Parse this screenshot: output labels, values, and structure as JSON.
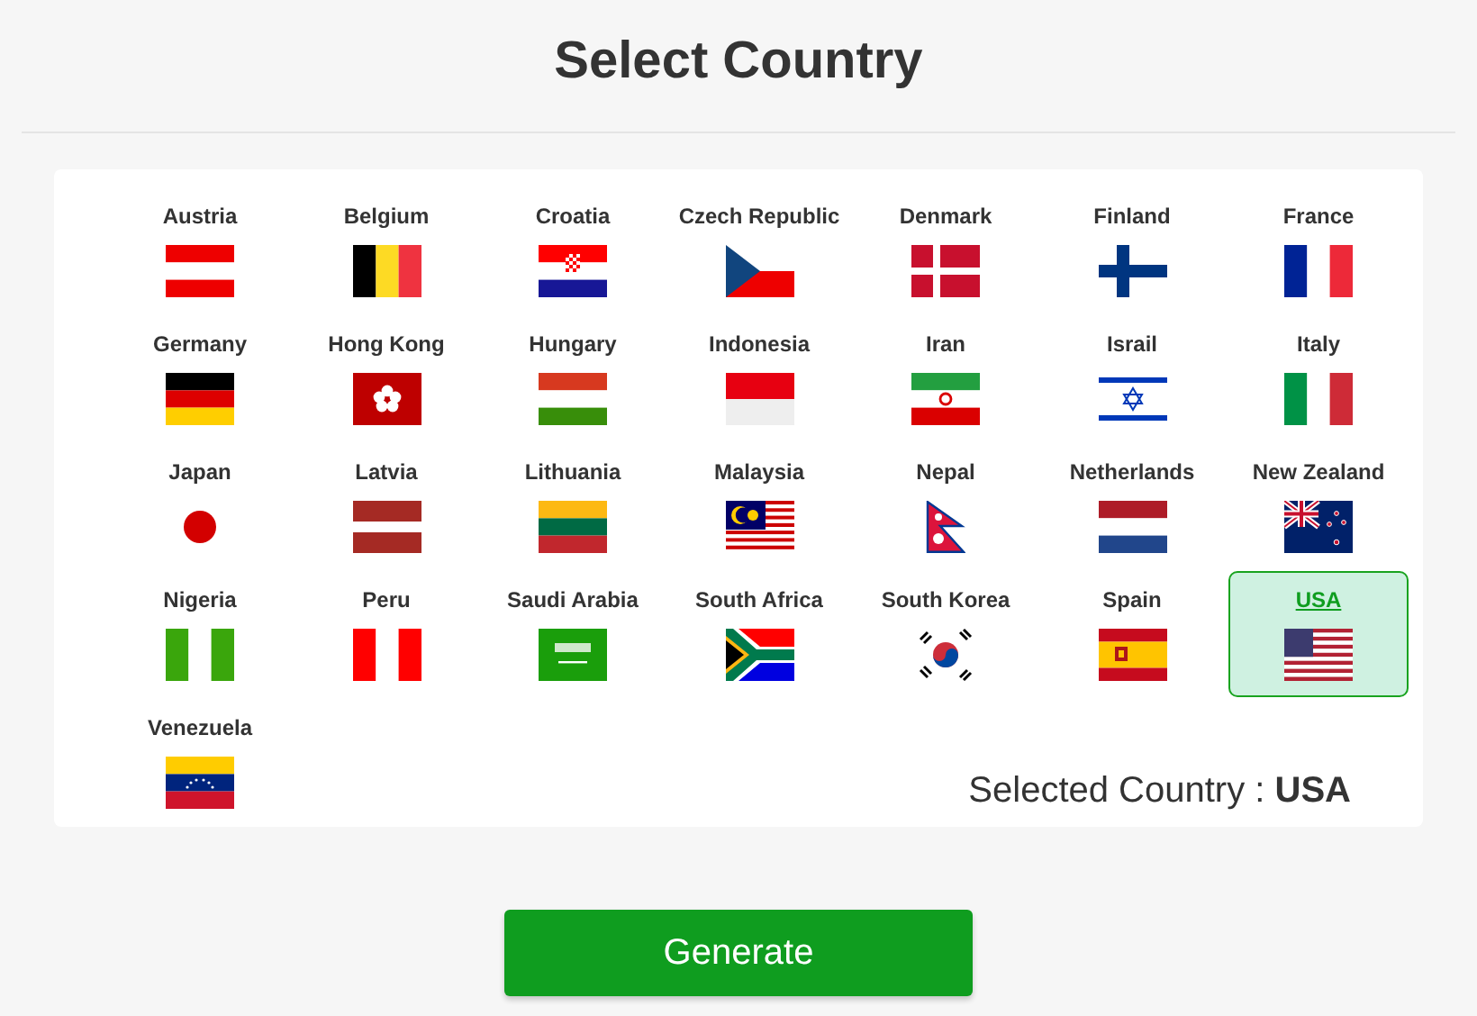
{
  "title": "Select Country",
  "countries": [
    {
      "name": "Austria",
      "selected": false
    },
    {
      "name": "Belgium",
      "selected": false
    },
    {
      "name": "Croatia",
      "selected": false
    },
    {
      "name": "Czech Republic",
      "selected": false
    },
    {
      "name": "Denmark",
      "selected": false
    },
    {
      "name": "Finland",
      "selected": false
    },
    {
      "name": "France",
      "selected": false
    },
    {
      "name": "Germany",
      "selected": false
    },
    {
      "name": "Hong Kong",
      "selected": false
    },
    {
      "name": "Hungary",
      "selected": false
    },
    {
      "name": "Indonesia",
      "selected": false
    },
    {
      "name": "Iran",
      "selected": false
    },
    {
      "name": "Israil",
      "selected": false
    },
    {
      "name": "Italy",
      "selected": false
    },
    {
      "name": "Japan",
      "selected": false
    },
    {
      "name": "Latvia",
      "selected": false
    },
    {
      "name": "Lithuania",
      "selected": false
    },
    {
      "name": "Malaysia",
      "selected": false
    },
    {
      "name": "Nepal",
      "selected": false
    },
    {
      "name": "Netherlands",
      "selected": false
    },
    {
      "name": "New Zealand",
      "selected": false
    },
    {
      "name": "Nigeria",
      "selected": false
    },
    {
      "name": "Peru",
      "selected": false
    },
    {
      "name": "Saudi Arabia",
      "selected": false
    },
    {
      "name": "South Africa",
      "selected": false
    },
    {
      "name": "South Korea",
      "selected": false
    },
    {
      "name": "Spain",
      "selected": false
    },
    {
      "name": "USA",
      "selected": true
    },
    {
      "name": "Venezuela",
      "selected": false
    }
  ],
  "selected_label": "Selected Country :",
  "selected_value": "USA",
  "button": "Generate"
}
